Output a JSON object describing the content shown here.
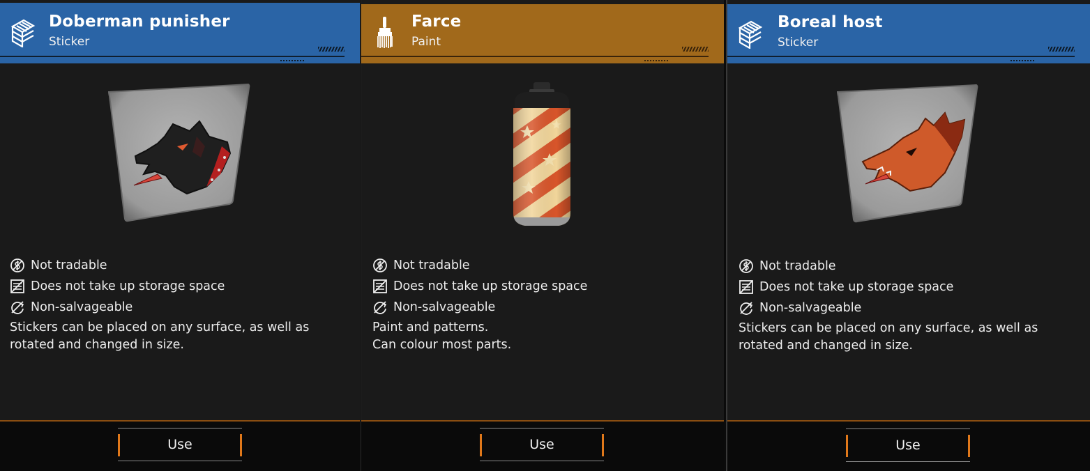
{
  "cards": [
    {
      "title": "Doberman punisher",
      "subtitle": "Sticker",
      "category_icon": "sticker-stack-icon",
      "accent_color": "#2a64a6",
      "item_icon": "doberman-sticker-image",
      "properties": [
        "Not tradable",
        "Does not take up storage space",
        "Non-salvageable"
      ],
      "description": "Stickers can be placed on any surface, as well as\nrotated and changed in size.",
      "button_label": "Use"
    },
    {
      "title": "Farce",
      "subtitle": "Paint",
      "category_icon": "paintbrush-icon",
      "accent_color": "#a1691b",
      "item_icon": "spray-can-image",
      "properties": [
        "Not tradable",
        "Does not take up storage space",
        "Non-salvageable"
      ],
      "description": "Paint and patterns.\nCan colour most parts.",
      "button_label": "Use"
    },
    {
      "title": "Boreal host",
      "subtitle": "Sticker",
      "category_icon": "sticker-stack-icon",
      "accent_color": "#2a64a6",
      "item_icon": "wolf-sticker-image",
      "properties": [
        "Not tradable",
        "Does not take up storage space",
        "Non-salvageable"
      ],
      "description": "Stickers can be placed on any surface, as well as\nrotated and changed in size.",
      "button_label": "Use"
    }
  ],
  "property_icons": [
    "not-tradable-icon",
    "no-storage-icon",
    "non-salvageable-icon"
  ]
}
